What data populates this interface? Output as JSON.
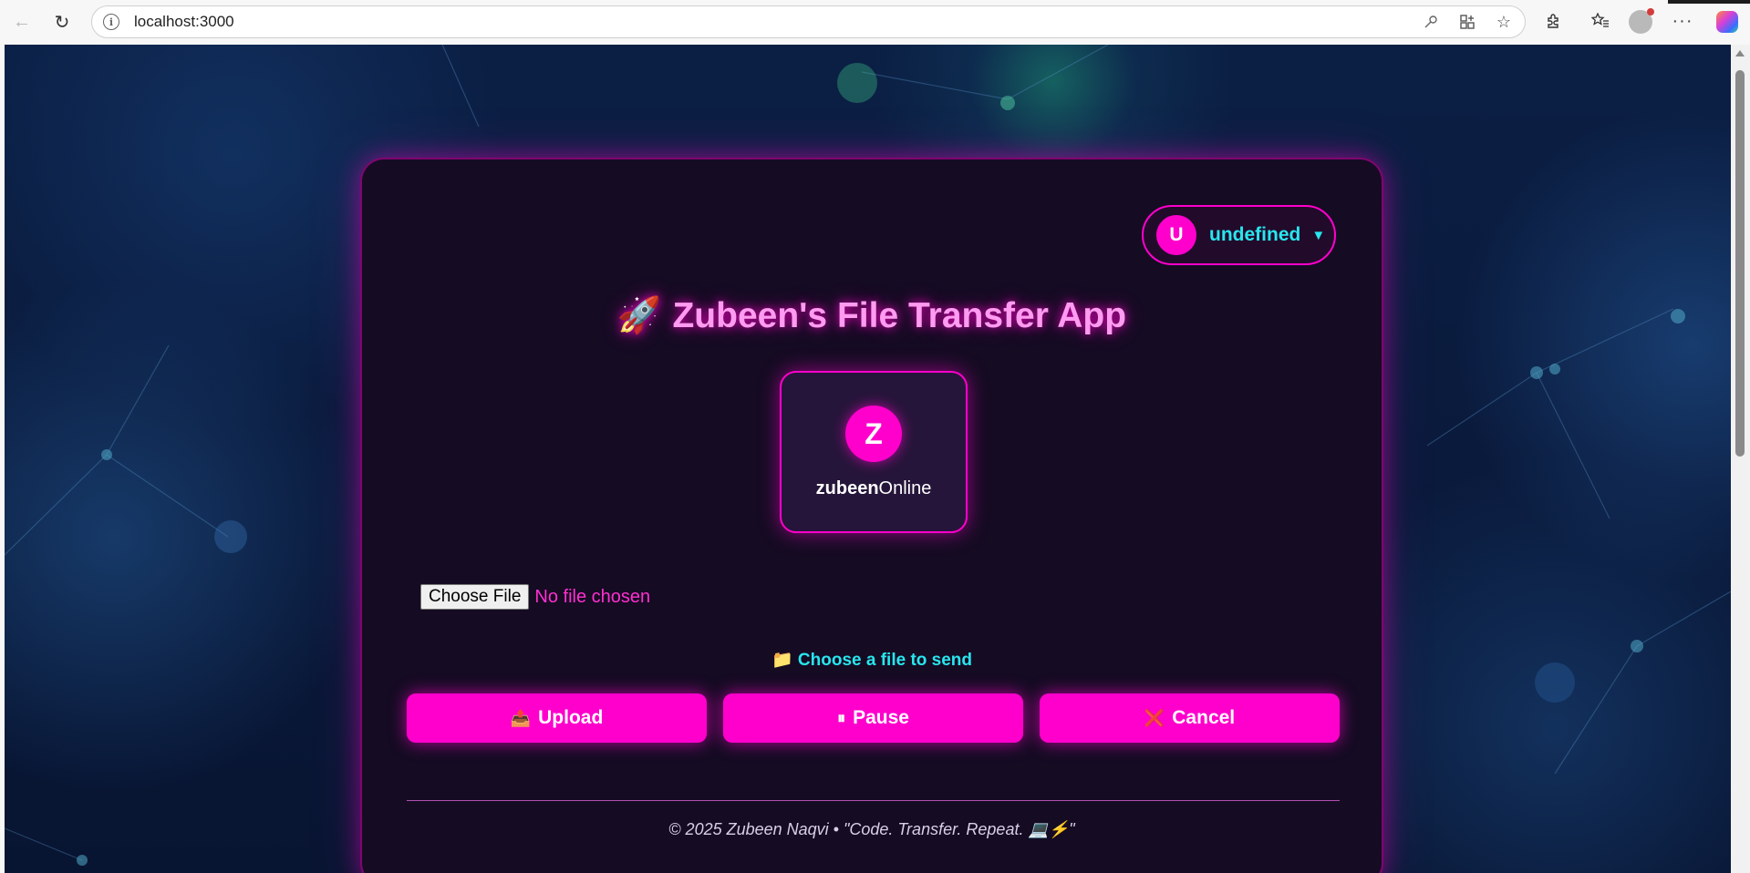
{
  "browser": {
    "url": "localhost:3000",
    "icons": [
      "back-icon",
      "reload-icon",
      "info-icon",
      "key-icon",
      "app-grid-icon",
      "star-icon",
      "extensions-icon",
      "favorites-icon",
      "profile-icon",
      "more-icon",
      "copilot-icon"
    ]
  },
  "user_menu": {
    "avatar_letter": "U",
    "name": "undefined",
    "caret": "▼"
  },
  "app": {
    "rocket": "🚀",
    "title": "Zubeen's File Transfer App"
  },
  "online_user": {
    "avatar_letter": "Z",
    "name": "zubeen",
    "status": "Online"
  },
  "file_input": {
    "button_label": "Choose File",
    "status": "No file chosen"
  },
  "hint": {
    "icon": "📁",
    "text": "Choose a file to send"
  },
  "buttons": {
    "upload": {
      "icon": "📤",
      "label": "Upload"
    },
    "pause": {
      "icon": "⏸",
      "label": "Pause"
    },
    "cancel": {
      "icon": "❌",
      "label": "Cancel"
    }
  },
  "footer": {
    "text": "© 2025 Zubeen Naqvi • \"Code. Transfer. Repeat. 💻⚡\""
  },
  "colors": {
    "accent": "#ff00cc",
    "cyan": "#28e6ee",
    "card_bg": "#150b23"
  }
}
